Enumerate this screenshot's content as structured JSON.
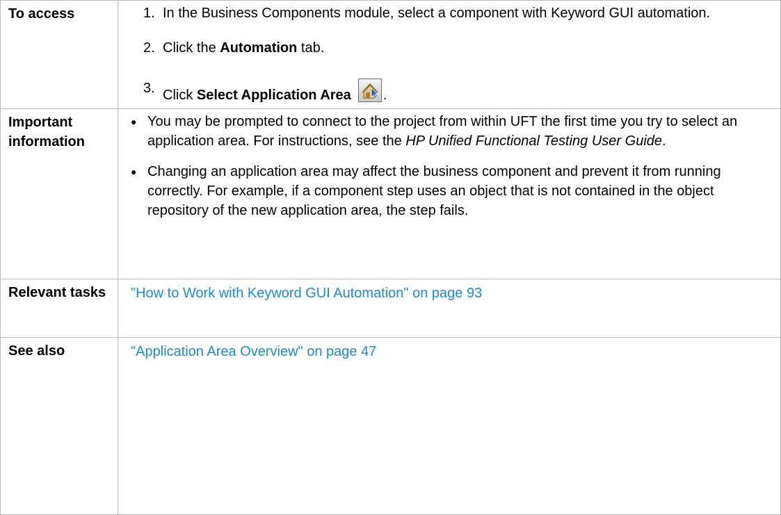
{
  "rows": {
    "access": {
      "label": "To access",
      "steps": [
        {
          "num": "1.",
          "text": "In the Business Components module, select a component with Keyword GUI automation."
        },
        {
          "num": "2.",
          "prefix": "Click the ",
          "bold": "Automation",
          "suffix": " tab."
        },
        {
          "num": "3.",
          "prefix": "Click ",
          "bold": "Select Application Area",
          "icon": "select-application-area-icon",
          "suffix": "."
        }
      ]
    },
    "important": {
      "label": "Important information",
      "bullets": [
        {
          "text": "You may be prompted to connect to the project from within UFT the first time you try to select an application area. For instructions, see the ",
          "italic": "HP Unified Functional Testing User Guide",
          "suffix": "."
        },
        {
          "text": "Changing an application area may affect the business component and prevent it from running correctly. For example, if a component step uses an object that is not contained in the object repository of the new application area, the step fails."
        }
      ]
    },
    "tasks": {
      "label": "Relevant tasks",
      "link": "\"How to Work with Keyword GUI Automation\" on page 93"
    },
    "see_also": {
      "label": "See also",
      "link": "\"Application Area Overview\" on page 47"
    }
  },
  "colors": {
    "link": "#1a8bd6",
    "border": "#b9b9b9"
  }
}
